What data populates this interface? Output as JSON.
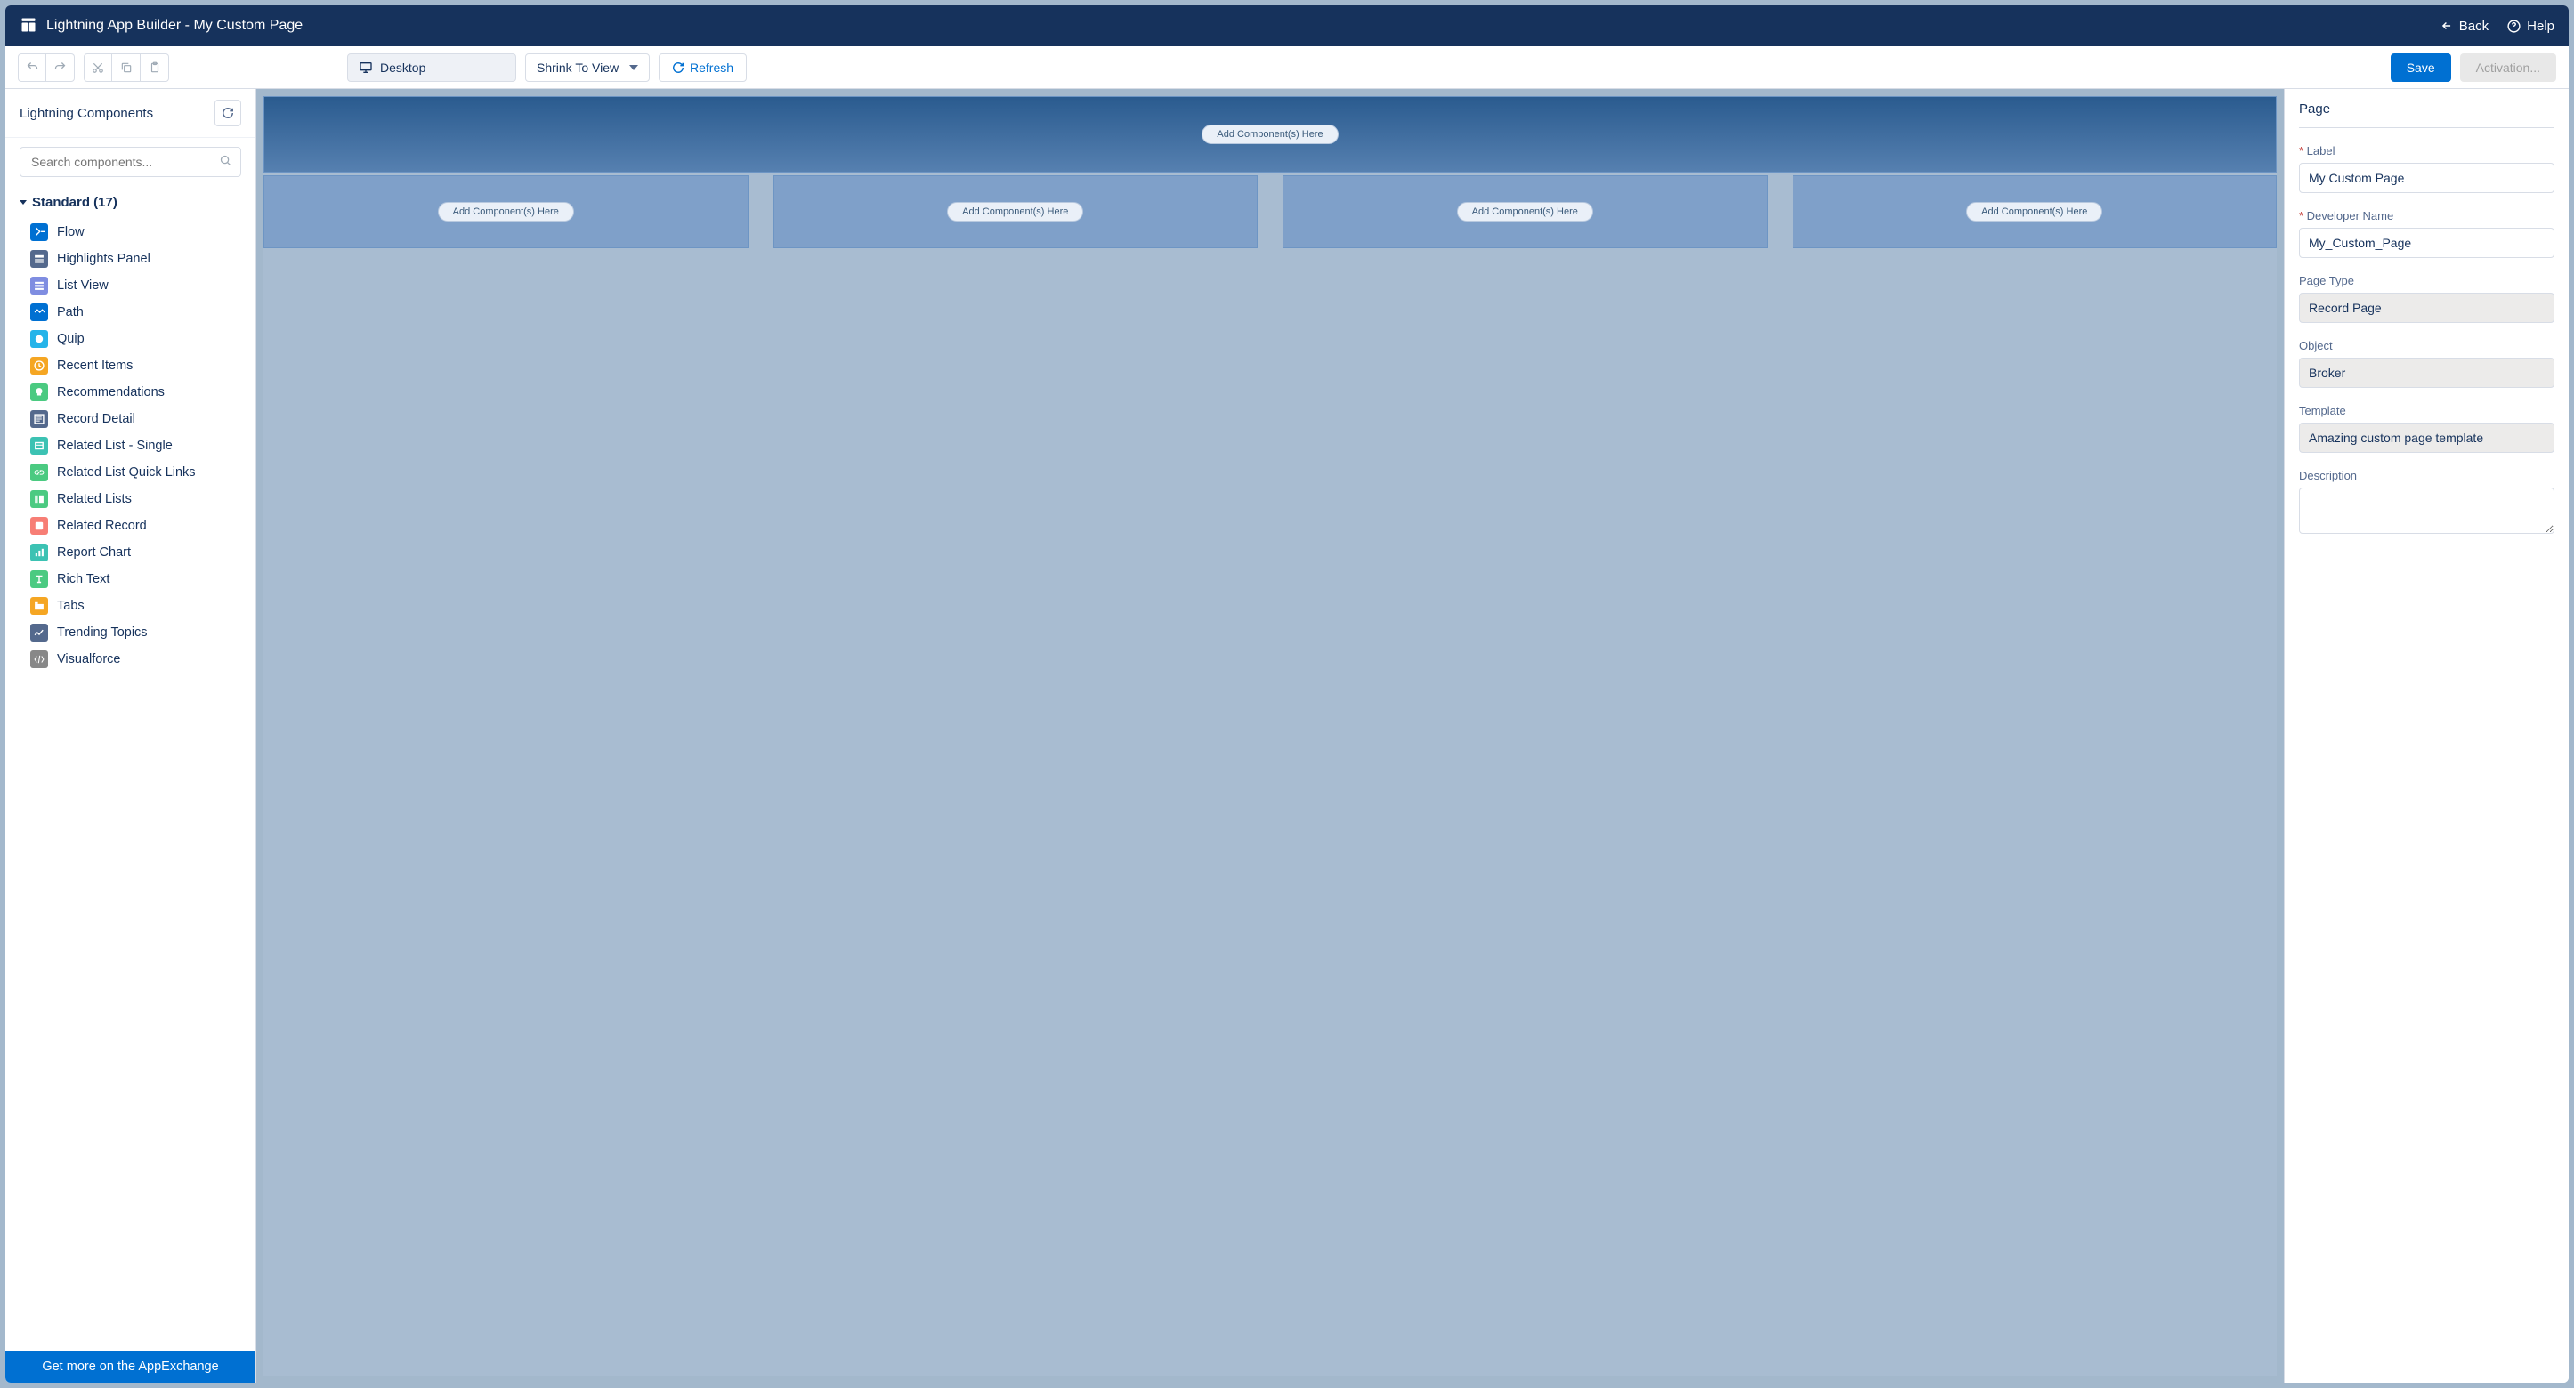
{
  "header": {
    "title": "Lightning App Builder - My Custom Page",
    "back_label": "Back",
    "help_label": "Help"
  },
  "toolbar": {
    "device_label": "Desktop",
    "shrink_label": "Shrink To View",
    "refresh_label": "Refresh",
    "save_label": "Save",
    "activation_label": "Activation..."
  },
  "sidebar": {
    "title": "Lightning Components",
    "search_placeholder": "Search components...",
    "section_label": "Standard (17)",
    "items": [
      {
        "label": "Flow",
        "color": "#0070d2",
        "icon": "flow"
      },
      {
        "label": "Highlights Panel",
        "color": "#54698d",
        "icon": "panel"
      },
      {
        "label": "List View",
        "color": "#7f8de1",
        "icon": "list"
      },
      {
        "label": "Path",
        "color": "#0070d2",
        "icon": "path"
      },
      {
        "label": "Quip",
        "color": "#25b4e9",
        "icon": "quip"
      },
      {
        "label": "Recent Items",
        "color": "#f5a623",
        "icon": "clock"
      },
      {
        "label": "Recommendations",
        "color": "#4bca81",
        "icon": "bulb"
      },
      {
        "label": "Record Detail",
        "color": "#54698d",
        "icon": "detail"
      },
      {
        "label": "Related List - Single",
        "color": "#3cc2b3",
        "icon": "list1"
      },
      {
        "label": "Related List Quick Links",
        "color": "#4bca81",
        "icon": "links"
      },
      {
        "label": "Related Lists",
        "color": "#4bca81",
        "icon": "lists"
      },
      {
        "label": "Related Record",
        "color": "#f77e75",
        "icon": "record"
      },
      {
        "label": "Report Chart",
        "color": "#3cc2b3",
        "icon": "chart"
      },
      {
        "label": "Rich Text",
        "color": "#4bca81",
        "icon": "text"
      },
      {
        "label": "Tabs",
        "color": "#f5a623",
        "icon": "tabs"
      },
      {
        "label": "Trending Topics",
        "color": "#54698d",
        "icon": "trend"
      },
      {
        "label": "Visualforce",
        "color": "#888888",
        "icon": "vf"
      }
    ],
    "footer_label": "Get more on the AppExchange"
  },
  "canvas": {
    "drop_hint": "Add Component(s) Here"
  },
  "properties": {
    "panel_title": "Page",
    "label_field": "Label",
    "label_value": "My Custom Page",
    "devname_field": "Developer Name",
    "devname_value": "My_Custom_Page",
    "pagetype_field": "Page Type",
    "pagetype_value": "Record Page",
    "object_field": "Object",
    "object_value": "Broker",
    "template_field": "Template",
    "template_value": "Amazing custom page template",
    "description_field": "Description",
    "description_value": ""
  }
}
